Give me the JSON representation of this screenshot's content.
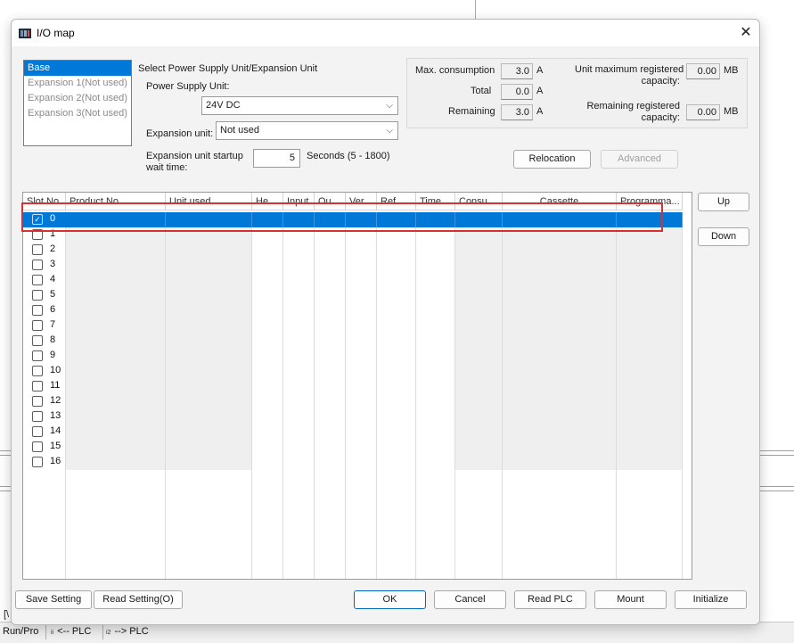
{
  "dialog": {
    "title": "I/O map",
    "close_glyph": "✕"
  },
  "units_list": [
    {
      "label": "Base",
      "selected": true
    },
    {
      "label": "Expansion 1(Not used)",
      "selected": false
    },
    {
      "label": "Expansion 2(Not used)",
      "selected": false
    },
    {
      "label": "Expansion 3(Not used)",
      "selected": false
    }
  ],
  "select": {
    "section_label": "Select Power Supply Unit/Expansion Unit",
    "power_supply_label": "Power Supply Unit:",
    "power_supply_value": "24V DC",
    "expansion_label": "Expansion unit:",
    "expansion_value": "Not used",
    "startup_label_1": "Expansion unit startup",
    "startup_label_2": "wait time:",
    "startup_value": "5",
    "startup_unit": "Seconds (5 - 1800)"
  },
  "consumption": {
    "max_label": "Max. consumption",
    "max_value": "3.0",
    "total_label": "Total",
    "total_value": "0.0",
    "remaining_label": "Remaining",
    "remaining_value": "3.0",
    "unit": "A"
  },
  "capacity": {
    "max_label_1": "Unit maximum registered",
    "max_label_2": "capacity:",
    "max_value": "0.00",
    "remaining_label_1": "Remaining registered",
    "remaining_label_2": "capacity:",
    "remaining_value": "0.00",
    "unit": "MB"
  },
  "buttons": {
    "relocation": "Relocation",
    "advanced": "Advanced",
    "up": "Up",
    "down": "Down",
    "save_setting": "Save Setting",
    "read_setting": "Read Setting(O)",
    "ok": "OK",
    "cancel": "Cancel",
    "read_plc": "Read PLC",
    "mount": "Mount",
    "initialize": "Initialize"
  },
  "table": {
    "columns": [
      "Slot No.",
      "Product No.",
      "Unit used",
      "He...",
      "Input",
      "Ou...",
      "Ver...",
      "Ref...",
      "Time...",
      "Consu...",
      "Cassette",
      "Programma..."
    ],
    "slots": [
      "0",
      "1",
      "2",
      "3",
      "4",
      "5",
      "6",
      "7",
      "8",
      "9",
      "10",
      "11",
      "12",
      "13",
      "14",
      "15",
      "16"
    ],
    "selected_slot": "0",
    "check_glyph": "✓"
  },
  "background": {
    "status_items": [
      "Run/Pro",
      "<-- PLC",
      "--> PLC"
    ],
    "status_small": [
      "ii",
      "i2"
    ],
    "left_marker": "[\\"
  },
  "colors": {
    "selection": "#0078d7",
    "highlight_box": "#d93030",
    "disabled_text": "#a0a0a0"
  }
}
